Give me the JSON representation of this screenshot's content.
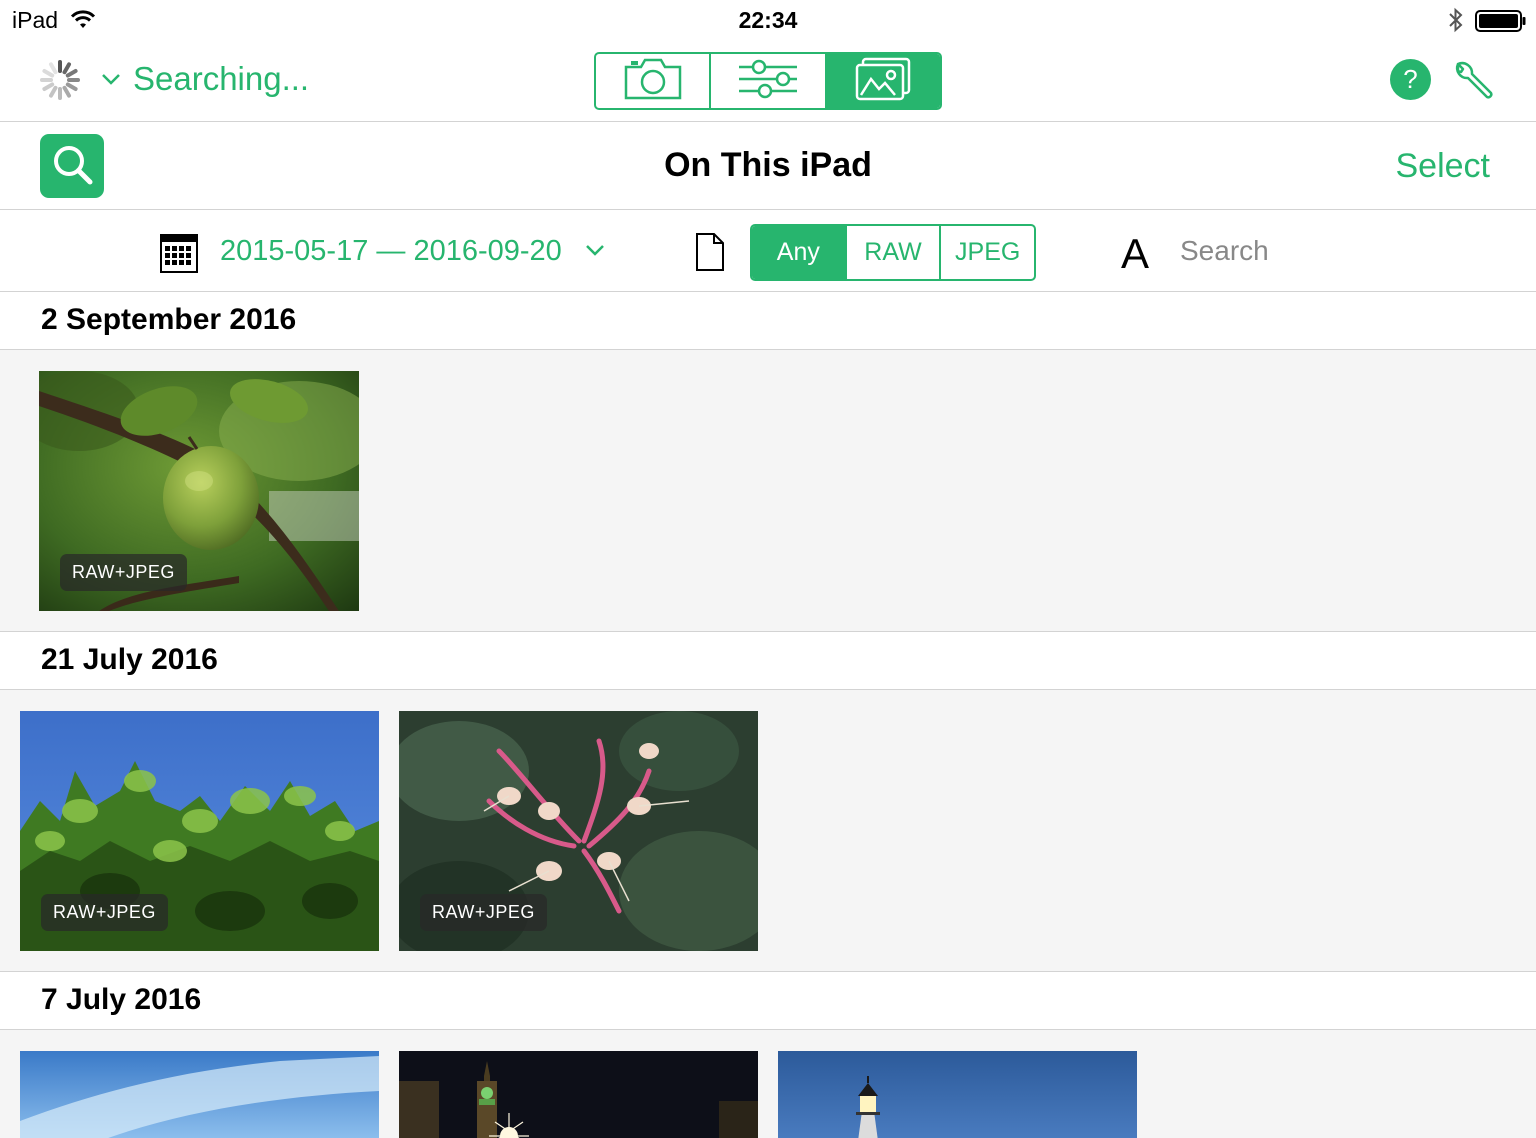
{
  "status_bar": {
    "device": "iPad",
    "time": "22:34"
  },
  "toolbar": {
    "status_label": "Searching...",
    "mode_tabs": [
      {
        "icon": "camera-icon",
        "active": false
      },
      {
        "icon": "sliders-icon",
        "active": false
      },
      {
        "icon": "photos-icon",
        "active": true
      }
    ],
    "help_label": "?"
  },
  "nav": {
    "title": "On This iPad",
    "select_label": "Select"
  },
  "filter": {
    "date_range": "2015-05-17 — 2016-09-20",
    "file_types": [
      "Any",
      "RAW",
      "JPEG"
    ],
    "selected_file_type": "Any",
    "font_icon_label": "A",
    "search_placeholder": "Search"
  },
  "sections": [
    {
      "date": "2 September 2016",
      "photos": [
        {
          "subject": "apple",
          "badge": "RAW+JPEG"
        }
      ]
    },
    {
      "date": "21 July 2016",
      "photos": [
        {
          "subject": "leaves-sky",
          "badge": "RAW+JPEG"
        },
        {
          "subject": "honeysuckle",
          "badge": "RAW+JPEG"
        }
      ]
    },
    {
      "date": "7 July 2016",
      "photos": [
        {
          "subject": "sky"
        },
        {
          "subject": "big-ben-night"
        },
        {
          "subject": "lighthouse"
        }
      ]
    }
  ],
  "colors": {
    "accent": "#27b56e",
    "separator": "#d3d3d3",
    "content_background": "#f5f5f5"
  }
}
